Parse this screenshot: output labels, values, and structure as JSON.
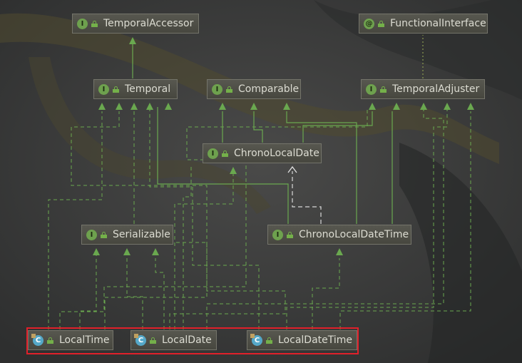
{
  "diagram": {
    "nodes": [
      {
        "id": "temporal_accessor",
        "kind": "interface",
        "badge": "I",
        "label": "TemporalAccessor"
      },
      {
        "id": "functional_interface",
        "kind": "annotation",
        "badge": "@",
        "label": "FunctionalInterface"
      },
      {
        "id": "temporal",
        "kind": "interface",
        "badge": "I",
        "label": "Temporal"
      },
      {
        "id": "comparable",
        "kind": "interface",
        "badge": "I",
        "label": "Comparable"
      },
      {
        "id": "temporal_adjuster",
        "kind": "interface",
        "badge": "I",
        "label": "TemporalAdjuster"
      },
      {
        "id": "chrono_local_date",
        "kind": "interface",
        "badge": "I",
        "label": "ChronoLocalDate"
      },
      {
        "id": "serializable",
        "kind": "interface",
        "badge": "I",
        "label": "Serializable"
      },
      {
        "id": "chrono_local_date_time",
        "kind": "interface",
        "badge": "I",
        "label": "ChronoLocalDateTime"
      },
      {
        "id": "local_time",
        "kind": "class",
        "badge": "C",
        "label": "LocalTime"
      },
      {
        "id": "local_date",
        "kind": "class",
        "badge": "C",
        "label": "LocalDate"
      },
      {
        "id": "local_date_time",
        "kind": "class",
        "badge": "C",
        "label": "LocalDateTime"
      }
    ],
    "edges": [
      {
        "from": "temporal",
        "to": "temporal_accessor",
        "type": "extends"
      },
      {
        "from": "temporal_adjuster",
        "to": "functional_interface",
        "type": "annotated"
      },
      {
        "from": "chrono_local_date",
        "to": "temporal",
        "type": "extends"
      },
      {
        "from": "chrono_local_date",
        "to": "comparable",
        "type": "extends"
      },
      {
        "from": "chrono_local_date",
        "to": "temporal_adjuster",
        "type": "extends"
      },
      {
        "from": "chrono_local_date_time",
        "to": "temporal",
        "type": "extends"
      },
      {
        "from": "chrono_local_date_time",
        "to": "comparable",
        "type": "extends"
      },
      {
        "from": "chrono_local_date_time",
        "to": "temporal_adjuster",
        "type": "extends"
      },
      {
        "from": "chrono_local_date_time",
        "to": "chrono_local_date",
        "type": "uses"
      },
      {
        "from": "local_time",
        "to": "temporal",
        "type": "implements"
      },
      {
        "from": "local_time",
        "to": "comparable",
        "type": "implements"
      },
      {
        "from": "local_time",
        "to": "temporal_adjuster",
        "type": "implements"
      },
      {
        "from": "local_time",
        "to": "serializable",
        "type": "implements"
      },
      {
        "from": "local_date",
        "to": "temporal",
        "type": "implements"
      },
      {
        "from": "local_date",
        "to": "temporal_adjuster",
        "type": "implements"
      },
      {
        "from": "local_date",
        "to": "chrono_local_date",
        "type": "implements"
      },
      {
        "from": "local_date",
        "to": "serializable",
        "type": "implements"
      },
      {
        "from": "local_date_time",
        "to": "temporal",
        "type": "implements"
      },
      {
        "from": "local_date_time",
        "to": "temporal_adjuster",
        "type": "implements"
      },
      {
        "from": "local_date_time",
        "to": "chrono_local_date_time",
        "type": "implements"
      },
      {
        "from": "local_date_time",
        "to": "serializable",
        "type": "implements"
      }
    ],
    "highlight_color": "#e0202a",
    "colors": {
      "extends": "#6aa84f",
      "implements": "#6aa84f",
      "uses": "#d8d8d8",
      "annotated": "#8a9a50"
    }
  }
}
